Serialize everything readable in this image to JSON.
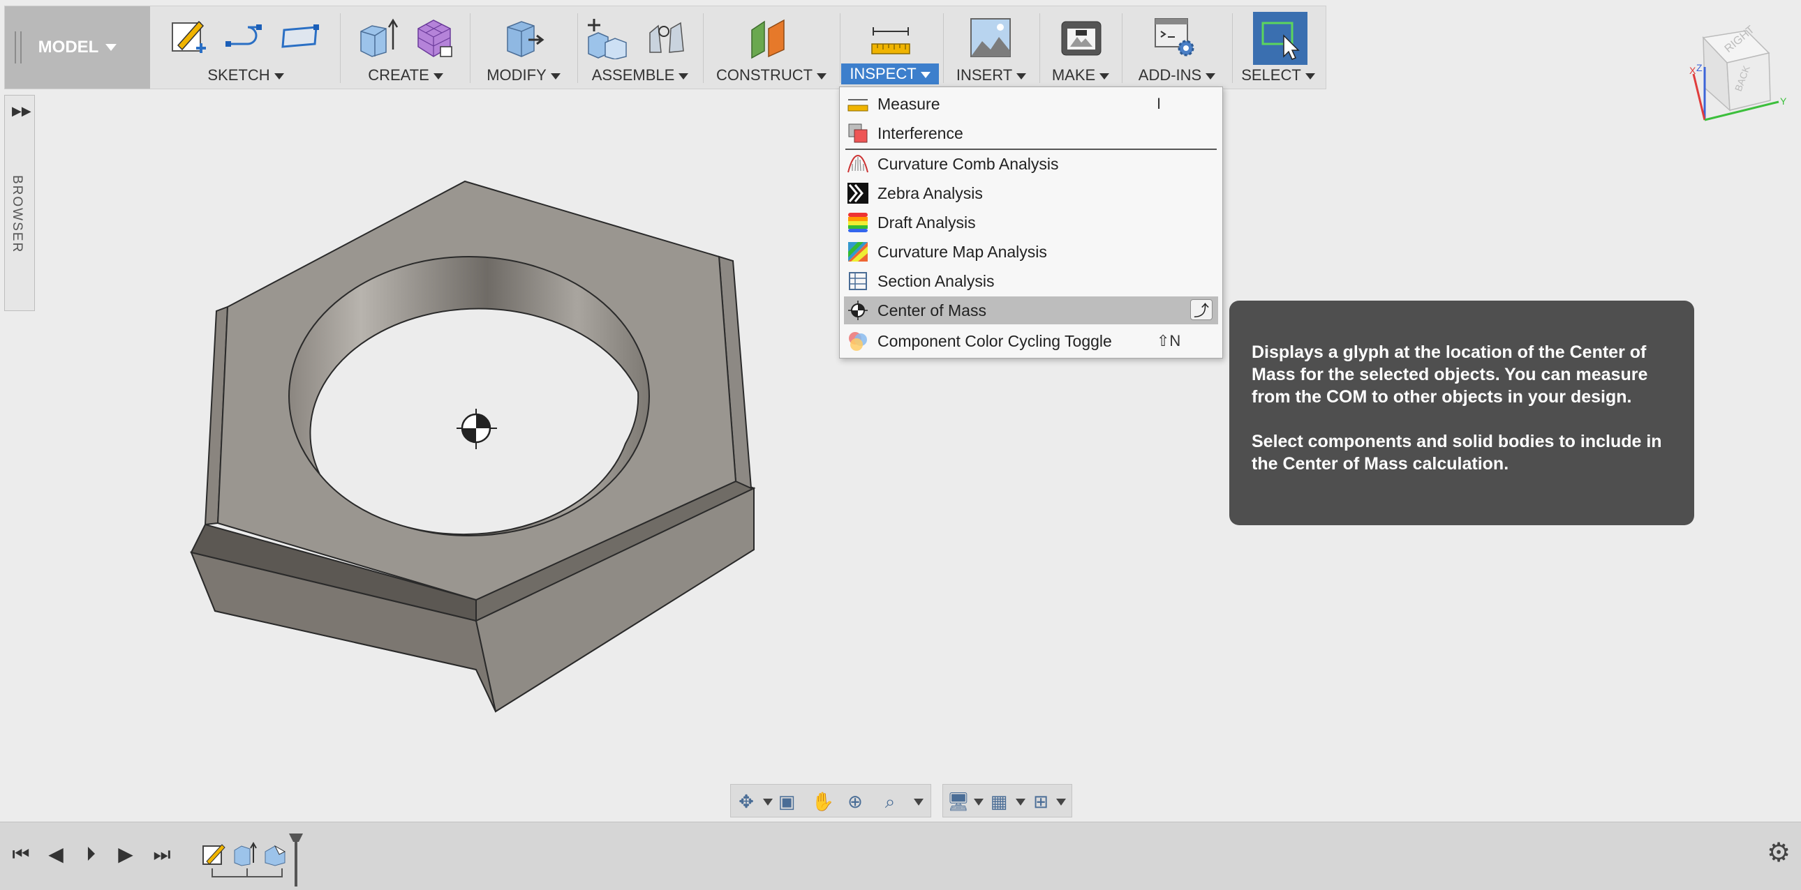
{
  "toolbar": {
    "mode_label": "MODEL",
    "groups": [
      {
        "label": "SKETCH"
      },
      {
        "label": "CREATE"
      },
      {
        "label": "MODIFY"
      },
      {
        "label": "ASSEMBLE"
      },
      {
        "label": "CONSTRUCT"
      },
      {
        "label": "INSPECT"
      },
      {
        "label": "INSERT"
      },
      {
        "label": "MAKE"
      },
      {
        "label": "ADD-INS"
      },
      {
        "label": "SELECT"
      }
    ],
    "active_group": "INSPECT",
    "accent_color": "#3d7fcc"
  },
  "inspect_menu": {
    "items": [
      {
        "label": "Measure",
        "shortcut": "I",
        "icon": "ruler-icon"
      },
      {
        "label": "Interference",
        "icon": "interference-icon"
      },
      {
        "label": "Curvature Comb Analysis",
        "icon": "curvature-comb-icon"
      },
      {
        "label": "Zebra Analysis",
        "icon": "zebra-icon"
      },
      {
        "label": "Draft Analysis",
        "icon": "draft-analysis-icon"
      },
      {
        "label": "Curvature Map Analysis",
        "icon": "curvature-map-icon"
      },
      {
        "label": "Section Analysis",
        "icon": "section-analysis-icon"
      },
      {
        "label": "Center of Mass",
        "icon": "center-of-mass-icon"
      },
      {
        "label": "Component Color Cycling Toggle",
        "shortcut": "⇧N",
        "icon": "color-cycling-icon"
      }
    ],
    "highlighted": "Center of Mass"
  },
  "tooltip": {
    "paragraph1": "Displays a glyph at the location of the Center of Mass for the selected objects. You can measure from the COM to other objects in your design.",
    "paragraph2": "Select components and solid bodies to include in the Center of Mass calculation."
  },
  "browser": {
    "label": "BROWSER"
  },
  "viewcube": {
    "faces": [
      "RIGHT",
      "BACK"
    ],
    "axes": [
      "X",
      "Y",
      "Z"
    ]
  }
}
